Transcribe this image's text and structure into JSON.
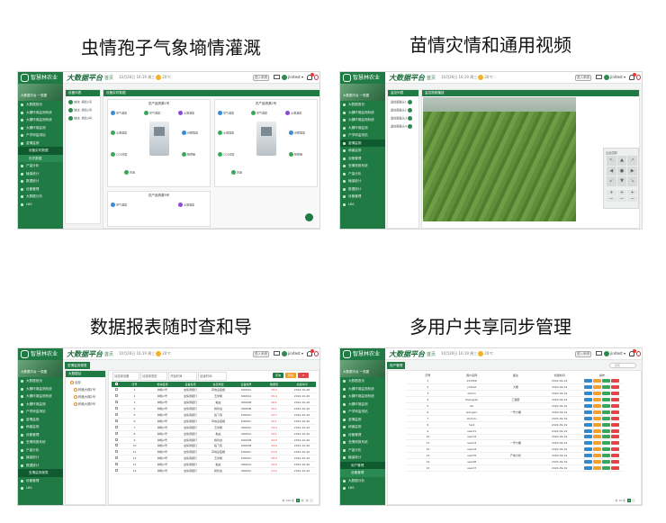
{
  "captions": [
    "虫情孢子气象墒情灌溉",
    "苗情灾情和通用视频",
    "数据报表随时查和导",
    "多用户共享同步管理"
  ],
  "app": {
    "logo_text": "智慧林农业",
    "brand": "大数据平台",
    "home": "首页",
    "weather": "10月26日 16:19 周三",
    "temperature": "20℃",
    "system_button": "进入系统",
    "username": "jinitest",
    "brand_color": "#1f7a44"
  },
  "sidebar": {
    "banner": "大数据平台 一张图",
    "items": [
      "大数据首页",
      "大棚环境监测系统",
      "大棚环境监测系统",
      "大棚环境监测",
      "产学研监测站",
      "苗情监测",
      "病害监测",
      "设备管理",
      "虫情测报系统",
      "产量分析",
      "植保统计",
      "数据统计",
      "设备管理",
      "大数据分析",
      "LBS"
    ],
    "sub_items": [
      "设备实时数据",
      "历史数据"
    ]
  },
  "panel1": {
    "crumb": "设备列表",
    "box_title": "设备列表",
    "main_title": "设备实时数据",
    "devices": [
      "地块: 墒情1号",
      "地块: 墒情2号",
      "地块: 墒情3号"
    ],
    "station_a": "农产品溯源1号",
    "station_b": "农产品溯源2号",
    "station_c": "农产品溯源3号",
    "sensors": [
      "空气温度",
      "空气湿度",
      "土壤温度",
      "土壤湿度",
      "光照强度",
      "CO2浓度",
      "降雨量",
      "风速"
    ]
  },
  "panel2": {
    "crumb": "监控列表",
    "box_title": "监控列表",
    "main_title": "监控视频播放",
    "cameras": [
      "监控摄像头1",
      "监控摄像头2",
      "监控摄像头3",
      "监控摄像头4"
    ],
    "ptz_title": "云台控制",
    "ptz_arrows": [
      "↖",
      "▲",
      "↗",
      "◀",
      "●",
      "▶",
      "↙",
      "▼",
      "↘"
    ],
    "ptz_zoom": [
      "+",
      "+",
      "+",
      "−",
      "−",
      "−"
    ]
  },
  "panel3": {
    "tab": "虫情监测报表",
    "tree_title": "大数据站",
    "tree": [
      "全部",
      "种植大棚1号",
      "种植大棚2号",
      "种植大棚3号"
    ],
    "filters": [
      "请选择设备",
      "请选择类型",
      "开始时间",
      "结束时间"
    ],
    "buttons": [
      "查询",
      "导出"
    ],
    "columns": [
      "序号",
      "地块名称",
      "设备名称",
      "虫害类型",
      "设备编号",
      "数据值",
      "采集时间"
    ],
    "rows": [
      [
        "1",
        "种植1号",
        "虫情测报灯",
        "草地贪夜蛾",
        "40000A",
        "38.0",
        "2022-10-26"
      ],
      [
        "2",
        "种植1号",
        "虫情测报灯",
        "玉米螟",
        "40000A",
        "36.4",
        "2022-10-26"
      ],
      [
        "3",
        "种植2号",
        "虫情测报灯",
        "黏虫",
        "40000B",
        "48.1",
        "2022-10-26"
      ],
      [
        "4",
        "种植2号",
        "虫情测报灯",
        "棉铃虫",
        "40000B",
        "30.1",
        "2022-10-26"
      ],
      [
        "5",
        "种植3号",
        "虫情测报灯",
        "稻飞虱",
        "40000C",
        "42.7",
        "2022-10-26"
      ],
      [
        "6",
        "种植3号",
        "虫情测报灯",
        "草地贪夜蛾",
        "40000C",
        "50.1",
        "2022-10-26"
      ],
      [
        "7",
        "种植1号",
        "虫情测报灯",
        "玉米螟",
        "40000A",
        "33.4",
        "2022-10-26"
      ],
      [
        "8",
        "种植1号",
        "虫情测报灯",
        "黏虫",
        "40000A",
        "29.1",
        "2022-10-26"
      ],
      [
        "9",
        "种植2号",
        "虫情测报灯",
        "棉铃虫",
        "40000B",
        "44.3",
        "2022-10-26"
      ],
      [
        "10",
        "种植2号",
        "虫情测报灯",
        "稻飞虱",
        "40000B",
        "34.0",
        "2022-10-26"
      ],
      [
        "11",
        "种植3号",
        "虫情测报灯",
        "草地贪夜蛾",
        "40000C",
        "41.8",
        "2022-10-26"
      ],
      [
        "12",
        "种植3号",
        "虫情测报灯",
        "玉米螟",
        "40000C",
        "38.9",
        "2022-10-26"
      ],
      [
        "13",
        "种植1号",
        "虫情测报灯",
        "黏虫",
        "40000A",
        "39.5",
        "2022-10-26"
      ],
      [
        "14",
        "种植1号",
        "虫情测报灯",
        "棉铃虫",
        "40000A",
        "37.2",
        "2022-10-26"
      ]
    ],
    "pager": "共 150 条"
  },
  "panel4": {
    "crumb": "用户管理",
    "search_placeholder": "搜索",
    "columns": [
      "序号",
      "用户名称",
      "备注",
      "创建时间",
      "操作"
    ],
    "rows": [
      [
        "1",
        "123456",
        "",
        "2022-09-19"
      ],
      [
        "2",
        "jinitest",
        "大棚",
        "2022-09-19"
      ],
      [
        "3",
        "admin",
        "",
        "2022-09-19"
      ],
      [
        "4",
        "zhangsan",
        "工程部",
        "2022-09-19"
      ],
      [
        "5",
        "lisi",
        "",
        "2022-09-19"
      ],
      [
        "6",
        "wangwu",
        "一号大棚",
        "2022-09-19"
      ],
      [
        "7",
        "zhaoliu",
        "",
        "2022-09-19"
      ],
      [
        "8",
        "test",
        "",
        "2022-09-19"
      ],
      [
        "9",
        "user01",
        "",
        "2022-09-19"
      ],
      [
        "10",
        "user02",
        "",
        "2022-09-19"
      ],
      [
        "11",
        "user03",
        "一号大棚",
        "2022-09-19"
      ],
      [
        "12",
        "user04",
        "",
        "2022-09-19"
      ],
      [
        "13",
        "user05",
        "产地分析",
        "2022-09-19"
      ],
      [
        "14",
        "user06",
        "",
        "2022-09-19"
      ],
      [
        "15",
        "user07",
        "",
        "2022-09-19"
      ]
    ],
    "op_colors": [
      "#2f8ad1",
      "#f0a02c",
      "#3aa65a",
      "#e04646"
    ],
    "pager": "共 15 条"
  }
}
